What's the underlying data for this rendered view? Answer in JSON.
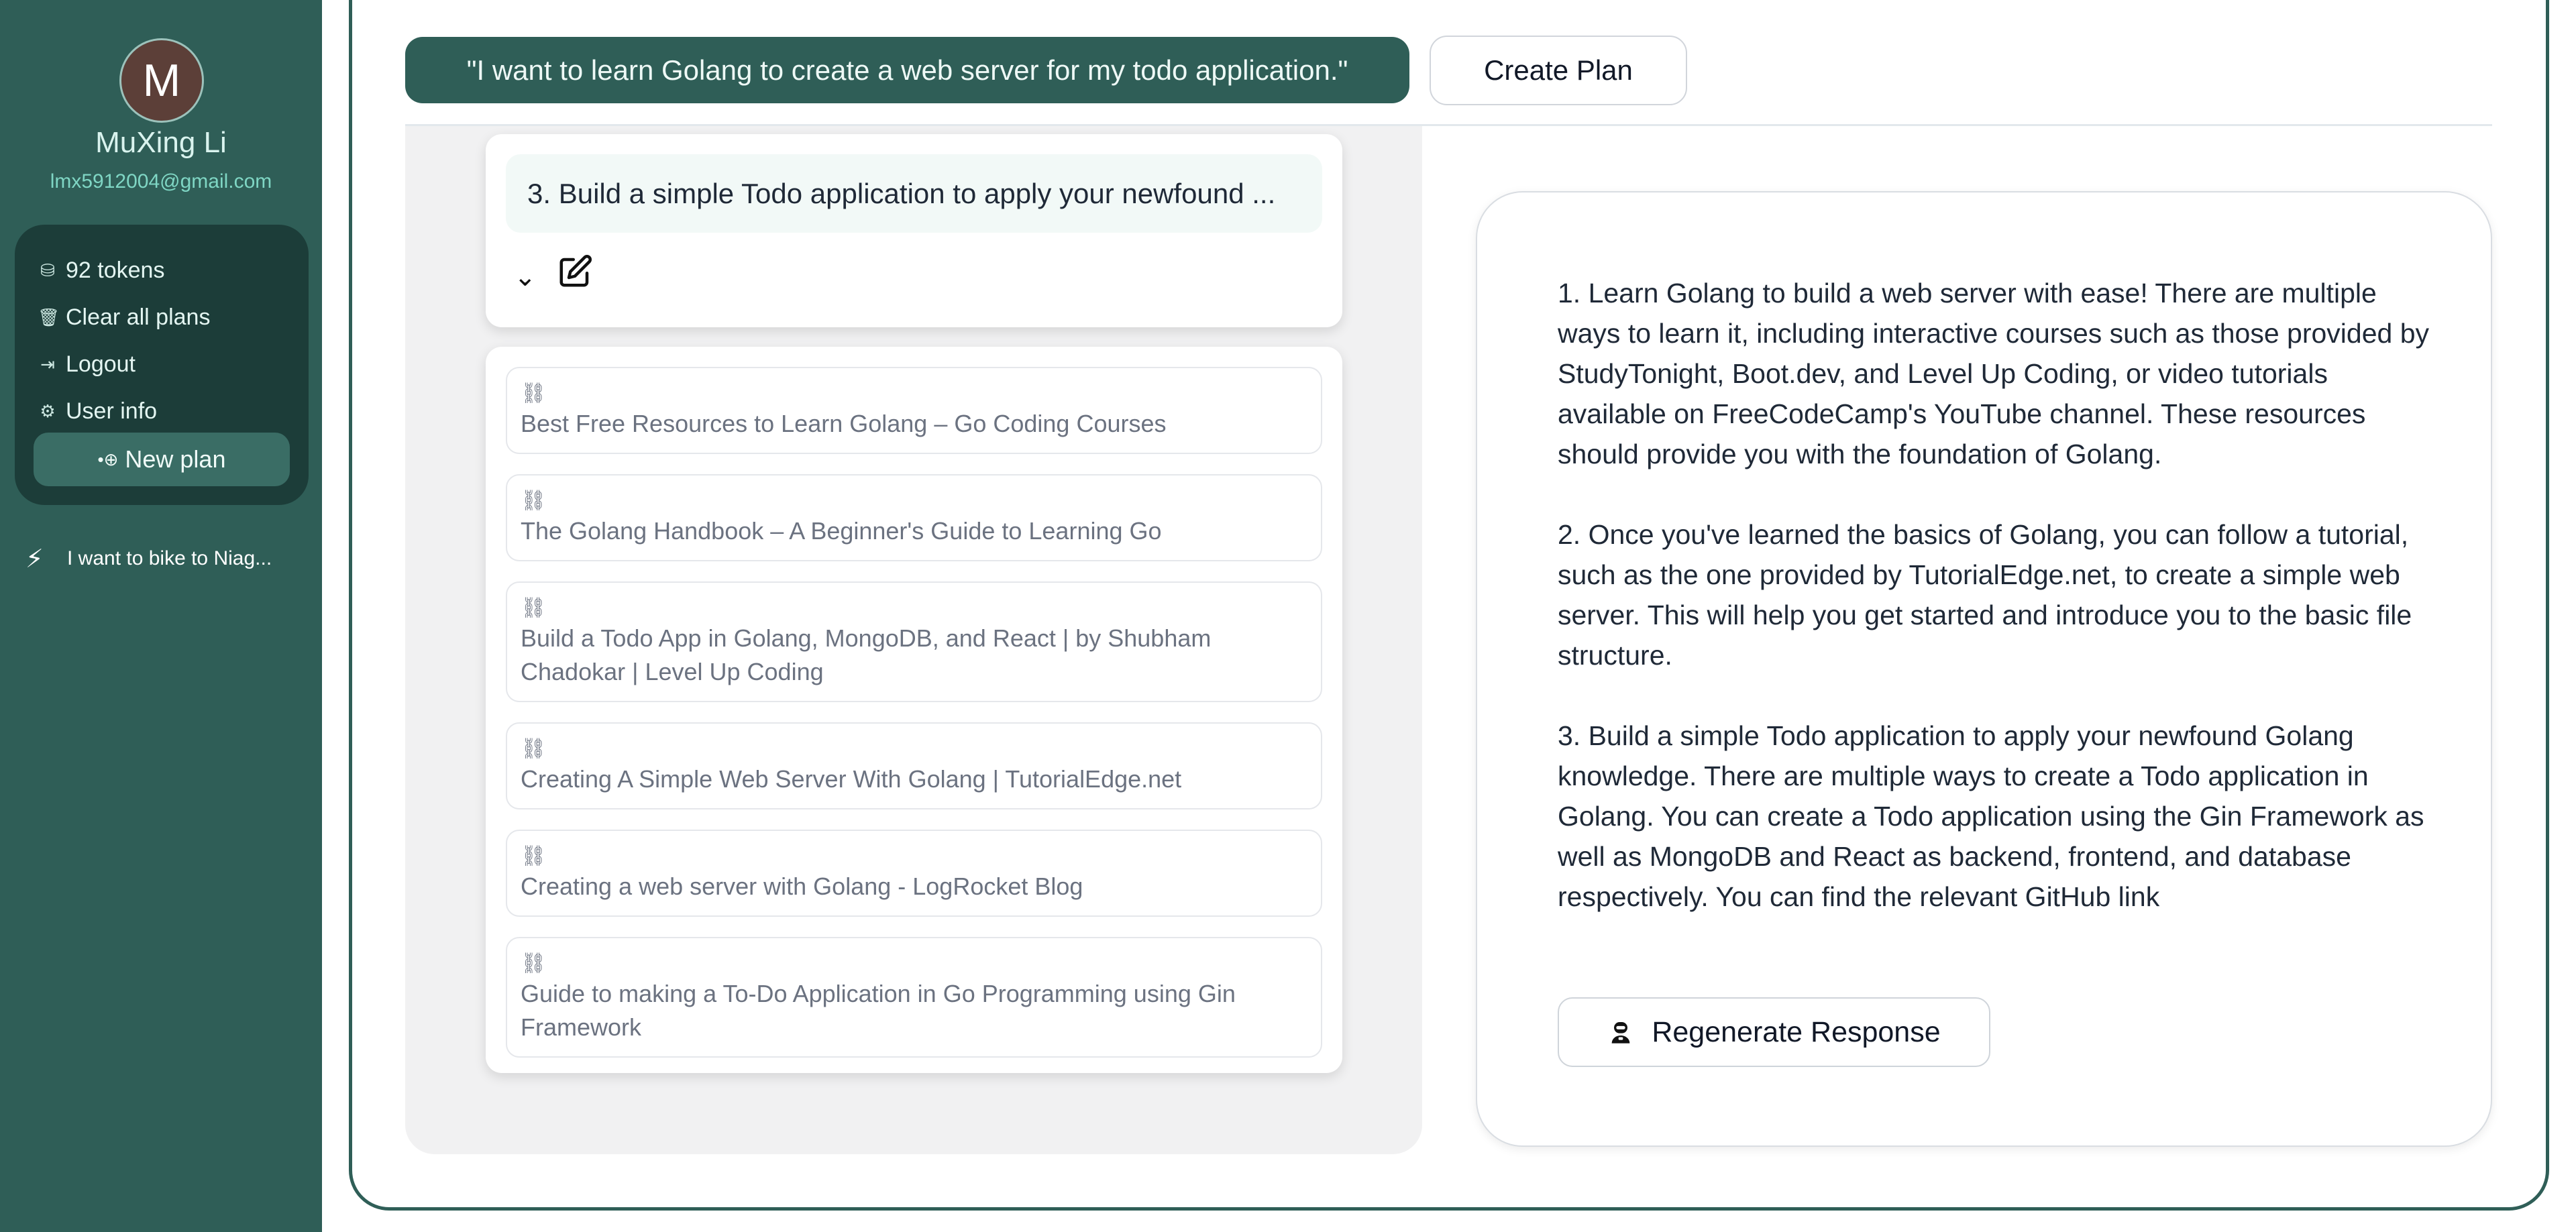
{
  "user": {
    "avatar_letter": "M",
    "name": "MuXing Li",
    "email": "lmx5912004@gmail.com"
  },
  "sidebar_menu": {
    "tokens": "92 tokens",
    "clear": "Clear all plans",
    "logout": "Logout",
    "user_info": "User info",
    "new_plan": "New plan"
  },
  "plans": [
    {
      "label": "I want to bike to Niag..."
    }
  ],
  "header": {
    "prompt": "\"I want to learn Golang to create a web server for my todo application.\"",
    "create_label": "Create Plan"
  },
  "step": {
    "text": "3. Build a simple Todo application to apply your newfound ..."
  },
  "links": [
    {
      "title": "Best Free Resources to Learn Golang – Go Coding Courses"
    },
    {
      "title": "The Golang Handbook – A Beginner's Guide to Learning Go"
    },
    {
      "title": "Build a Todo App in Golang, MongoDB, and React | by Shubham Chadokar | Level Up Coding"
    },
    {
      "title": "Creating A Simple Web Server With Golang | TutorialEdge.net"
    },
    {
      "title": "Creating a web server with Golang - LogRocket Blog"
    },
    {
      "title": "Guide to making a To-Do Application in Go Programming using Gin Framework"
    }
  ],
  "response": {
    "paragraphs": [
      "1. Learn Golang to build a web server with ease! There are multiple ways to learn it, including interactive courses such as those provided by StudyTonight, Boot.dev, and Level Up Coding, or video tutorials available on FreeCodeCamp's YouTube channel. These resources should provide you with the foundation of Golang.",
      "2. Once you've learned the basics of Golang, you can follow a tutorial, such as the one provided by TutorialEdge.net, to create a simple web server. This will help you get started and introduce you to the basic file structure.",
      "3. Build a simple Todo application to apply your newfound Golang knowledge. There are multiple ways to create a Todo application in Golang. You can create a Todo application using the Gin Framework as well as MongoDB and React as backend, frontend, and database respectively. You can find the relevant GitHub link"
    ],
    "regenerate_label": "Regenerate Response"
  },
  "icons": {
    "tokens": "coin-icon",
    "clear": "trash-icon",
    "logout": "logout-icon",
    "user_info": "gear-icon",
    "new_plan": "plus-icon",
    "plan": "bolt-icon",
    "link": "link-icon",
    "edit": "edit-icon",
    "collapse": "chevron-down-icon",
    "regenerate": "robot-icon"
  },
  "colors": {
    "brand": "#2f5e57",
    "brand_dark": "#1c3d39",
    "accent_text": "#7fd6c4"
  }
}
